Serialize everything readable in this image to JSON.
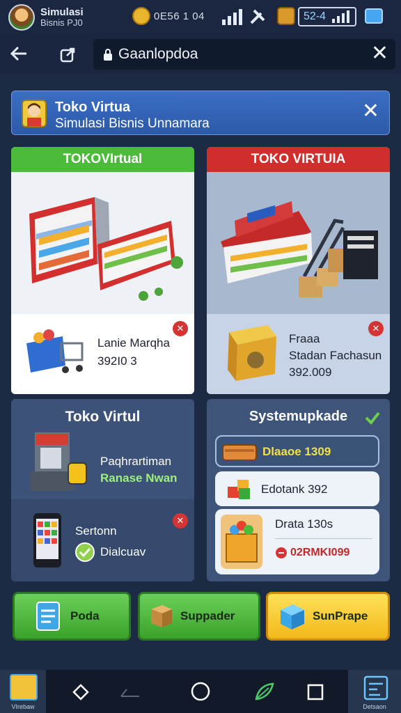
{
  "status_bar": {
    "app_name": "Simulasi",
    "app_sub": "Bisnis  PJ0",
    "coin_value": "0E56 1 04",
    "battery_text": "52-4"
  },
  "address_bar": {
    "url": "Gaanlopdoa"
  },
  "banner": {
    "title": "Toko Virtua",
    "subtitle": "Simulasi Bisnis Unnamara"
  },
  "cards": {
    "store_green": {
      "title": "TOKOVIrtual",
      "item_name": "Lanie Marqha",
      "item_value": "392I0 3"
    },
    "store_red": {
      "title": "TOKO VIRTUIA",
      "item_name": "Fraaa",
      "item_sub": "Stadan Fachasun",
      "item_value": "392.009"
    },
    "toko_dark": {
      "title": "Toko Virtul",
      "row1_line1": "Paqhrartiman",
      "row1_line2": "Ranase Nwan",
      "row2_line1": "Sertonn",
      "row2_line2": "Dialcuav"
    },
    "system_upgrade": {
      "title": "Systemupkade",
      "rows": [
        {
          "label": "Dlaaoe 1309"
        },
        {
          "label": "Edotank 392"
        },
        {
          "label": "Drata 130s",
          "sub": "02RMKI099"
        }
      ]
    }
  },
  "buttons": {
    "poda": "Poda",
    "supplier": "Suppader",
    "sunprape": "SunPrape"
  },
  "nav_bar": {
    "left_label": "VIrebaw",
    "right_label": "Detsaon"
  },
  "colors": {
    "accent_green": "#4cbb3a",
    "accent_red": "#cf2e2c",
    "accent_yellow": "#f2b81a",
    "banner_blue": "#2d5aa8"
  }
}
